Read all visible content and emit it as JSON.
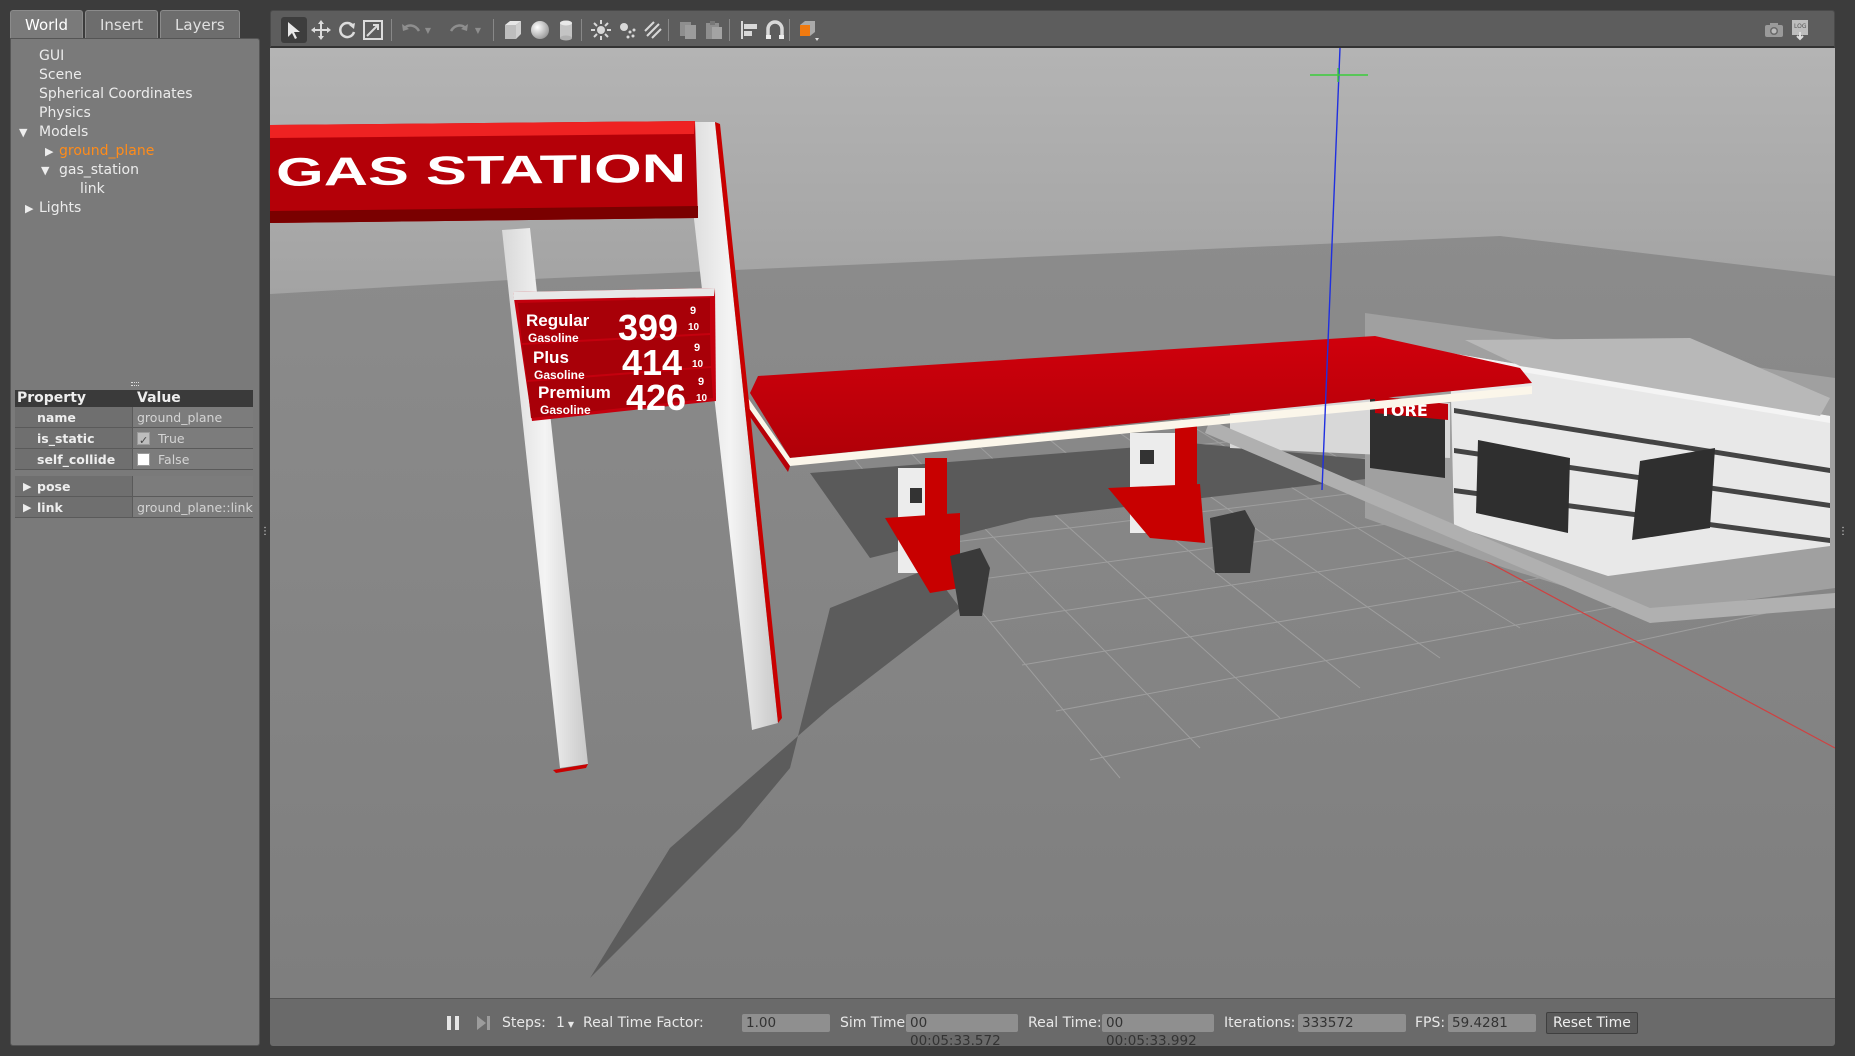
{
  "tabs": [
    "World",
    "Insert",
    "Layers"
  ],
  "tree": {
    "gui": "GUI",
    "scene": "Scene",
    "spherical": "Spherical Coordinates",
    "physics": "Physics",
    "models": "Models",
    "ground_plane": "ground_plane",
    "gas_station": "gas_station",
    "link": "link",
    "lights": "Lights"
  },
  "props": {
    "header_property": "Property",
    "header_value": "Value",
    "rows": [
      {
        "name": "name",
        "value": "ground_plane"
      },
      {
        "name": "is_static",
        "value": "True",
        "checked": true
      },
      {
        "name": "self_collide",
        "value": "False",
        "checked": false
      },
      {
        "name": "pose",
        "value": ""
      },
      {
        "name": "link",
        "value": "ground_plane::link"
      }
    ]
  },
  "toolbar_icons": [
    "select-icon",
    "translate-icon",
    "rotate-icon",
    "scale-icon",
    "undo-icon",
    "undo-dropdown-icon",
    "redo-icon",
    "redo-dropdown-icon",
    "box-icon",
    "sphere-icon",
    "cylinder-icon",
    "point-light-icon",
    "spot-light-icon",
    "directional-light-icon",
    "copy-icon",
    "paste-icon",
    "align-icon",
    "snap-icon",
    "view-angle-icon",
    "screenshot-icon",
    "log-icon"
  ],
  "sign": {
    "title": "GAS STATION",
    "prices": [
      {
        "grade": "Regular",
        "sub": "Gasoline",
        "price": "399",
        "frac_num": "9",
        "frac_den": "10"
      },
      {
        "grade": "Plus",
        "sub": "Gasoline",
        "price": "414",
        "frac_num": "9",
        "frac_den": "10"
      },
      {
        "grade": "Premium",
        "sub": "Gasoline",
        "price": "426",
        "frac_num": "9",
        "frac_den": "10"
      }
    ],
    "store": "TORE"
  },
  "bottom": {
    "steps_label": "Steps:",
    "steps_value": "1",
    "rtf_label": "Real Time Factor:",
    "rtf_value": "1.00",
    "sim_label": "Sim Time:",
    "sim_value": "00 00:05:33.572",
    "real_label": "Real Time:",
    "real_value": "00 00:05:33.992",
    "iter_label": "Iterations:",
    "iter_value": "333572",
    "fps_label": "FPS:",
    "fps_value": "59.4281",
    "reset_label": "Reset Time"
  },
  "colors": {
    "accent_selected": "#ff8c1a",
    "sign_red": "#c4000e",
    "canopy_red": "#c00008"
  }
}
